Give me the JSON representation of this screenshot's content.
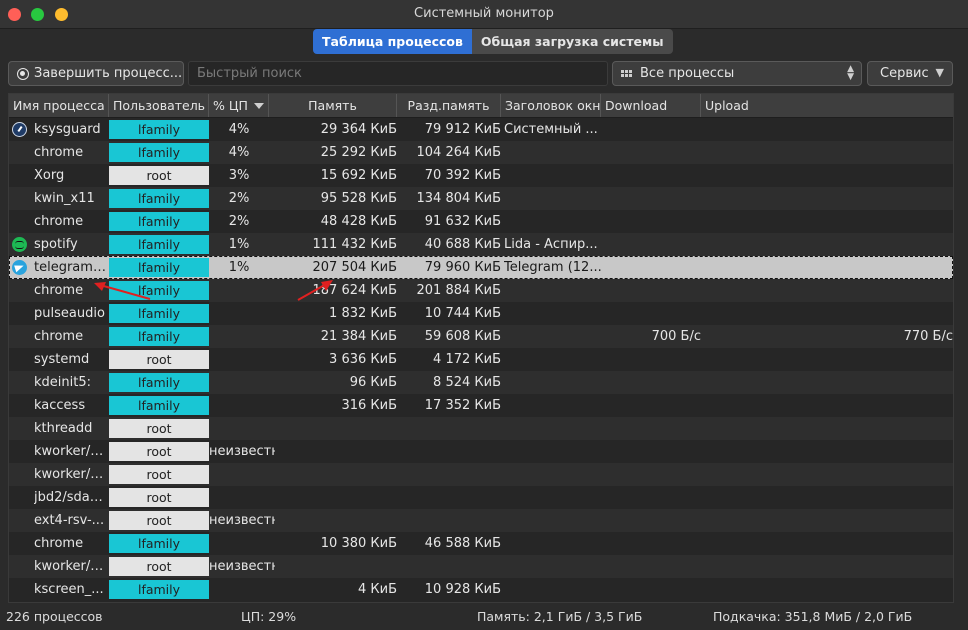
{
  "window": {
    "title": "Системный монитор"
  },
  "tabs": [
    {
      "label": "Таблица процессов",
      "active": true
    },
    {
      "label": "Общая загрузка системы",
      "active": false
    }
  ],
  "toolbar": {
    "end_process_label": "Завершить процесс...",
    "search_placeholder": "Быстрый поиск",
    "filter_value": "Все процессы",
    "service_label": "Сервис"
  },
  "columns": {
    "name": "Имя процесса",
    "user": "Пользователь",
    "cpu": "% ЦП",
    "memory": "Память",
    "shared": "Разд.память",
    "window_title": "Заголовок окна",
    "download": "Download",
    "upload": "Upload"
  },
  "rows": [
    {
      "icon": "ksysguard-icon",
      "name": "ksysguard",
      "user": "lfamily",
      "cpu": "4%",
      "memory": "29 364 КиБ",
      "shared": "79 912 КиБ",
      "window_title": "Системный ...",
      "download": "",
      "upload": ""
    },
    {
      "icon": "",
      "name": "chrome",
      "user": "lfamily",
      "cpu": "4%",
      "memory": "25 292 КиБ",
      "shared": "104 264 КиБ",
      "window_title": "",
      "download": "",
      "upload": ""
    },
    {
      "icon": "",
      "name": "Xorg",
      "user": "root",
      "cpu": "3%",
      "memory": "15 692 КиБ",
      "shared": "70 392 КиБ",
      "window_title": "",
      "download": "",
      "upload": ""
    },
    {
      "icon": "",
      "name": "kwin_x11",
      "user": "lfamily",
      "cpu": "2%",
      "memory": "95 528 КиБ",
      "shared": "134 804 КиБ",
      "window_title": "",
      "download": "",
      "upload": ""
    },
    {
      "icon": "",
      "name": "chrome",
      "user": "lfamily",
      "cpu": "2%",
      "memory": "48 428 КиБ",
      "shared": "91 632 КиБ",
      "window_title": "",
      "download": "",
      "upload": ""
    },
    {
      "icon": "spotify-icon",
      "name": "spotify",
      "user": "lfamily",
      "cpu": "1%",
      "memory": "111 432 КиБ",
      "shared": "40 688 КиБ",
      "window_title": "Lida - Аспир...",
      "download": "",
      "upload": ""
    },
    {
      "icon": "telegram-icon",
      "name": "telegram-...",
      "user": "lfamily",
      "cpu": "1%",
      "memory": "207 504 КиБ",
      "shared": "79 960 КиБ",
      "window_title": "Telegram (12...",
      "download": "",
      "upload": "",
      "selected": true
    },
    {
      "icon": "",
      "name": "chrome",
      "user": "lfamily",
      "cpu": "",
      "memory": "187 624 КиБ",
      "shared": "201 884 КиБ",
      "window_title": "",
      "download": "",
      "upload": ""
    },
    {
      "icon": "",
      "name": "pulseaudio",
      "user": "lfamily",
      "cpu": "",
      "memory": "1 832 КиБ",
      "shared": "10 744 КиБ",
      "window_title": "",
      "download": "",
      "upload": ""
    },
    {
      "icon": "",
      "name": "chrome",
      "user": "lfamily",
      "cpu": "",
      "memory": "21 384 КиБ",
      "shared": "59 608 КиБ",
      "window_title": "",
      "download": "700 Б/с",
      "upload": "770 Б/с"
    },
    {
      "icon": "",
      "name": "systemd",
      "user": "root",
      "cpu": "",
      "memory": "3 636 КиБ",
      "shared": "4 172 КиБ",
      "window_title": "",
      "download": "",
      "upload": ""
    },
    {
      "icon": "",
      "name": "kdeinit5:",
      "user": "lfamily",
      "cpu": "",
      "memory": "96 КиБ",
      "shared": "8 524 КиБ",
      "window_title": "",
      "download": "",
      "upload": ""
    },
    {
      "icon": "",
      "name": "kaccess",
      "user": "lfamily",
      "cpu": "",
      "memory": "316 КиБ",
      "shared": "17 352 КиБ",
      "window_title": "",
      "download": "",
      "upload": ""
    },
    {
      "icon": "",
      "name": "kthreadd",
      "user": "root",
      "cpu": "",
      "memory": "",
      "shared": "",
      "window_title": "",
      "download": "",
      "upload": ""
    },
    {
      "icon": "",
      "name": "kworker/2...",
      "user": "root",
      "cpu": "неизвестнь",
      "memory": "",
      "shared": "",
      "window_title": "",
      "download": "",
      "upload": ""
    },
    {
      "icon": "",
      "name": "kworker/3...",
      "user": "root",
      "cpu": "",
      "memory": "",
      "shared": "",
      "window_title": "",
      "download": "",
      "upload": ""
    },
    {
      "icon": "",
      "name": "jbd2/sda2...",
      "user": "root",
      "cpu": "",
      "memory": "",
      "shared": "",
      "window_title": "",
      "download": "",
      "upload": ""
    },
    {
      "icon": "",
      "name": "ext4-rsv-...",
      "user": "root",
      "cpu": "неизвестнь",
      "memory": "",
      "shared": "",
      "window_title": "",
      "download": "",
      "upload": ""
    },
    {
      "icon": "",
      "name": "chrome",
      "user": "lfamily",
      "cpu": "",
      "memory": "10 380 КиБ",
      "shared": "46 588 КиБ",
      "window_title": "",
      "download": "",
      "upload": ""
    },
    {
      "icon": "",
      "name": "kworker/3...",
      "user": "root",
      "cpu": "неизвестнь",
      "memory": "",
      "shared": "",
      "window_title": "",
      "download": "",
      "upload": ""
    },
    {
      "icon": "",
      "name": "kscreen_...",
      "user": "lfamily",
      "cpu": "",
      "memory": "4 КиБ",
      "shared": "10 928 КиБ",
      "window_title": "",
      "download": "",
      "upload": ""
    }
  ],
  "status": {
    "processes": "226 процессов",
    "cpu": "ЦП: 29%",
    "memory": "Память: 2,1 ГиБ / 3,5 ГиБ",
    "swap": "Подкачка: 351,8 МиБ / 2,0 ГиБ"
  },
  "colors": {
    "accent": "#2f6fd4",
    "user_lfamily": "#19c6d4",
    "user_root": "#e4e4e4",
    "annotation_arrow": "#e02020"
  }
}
